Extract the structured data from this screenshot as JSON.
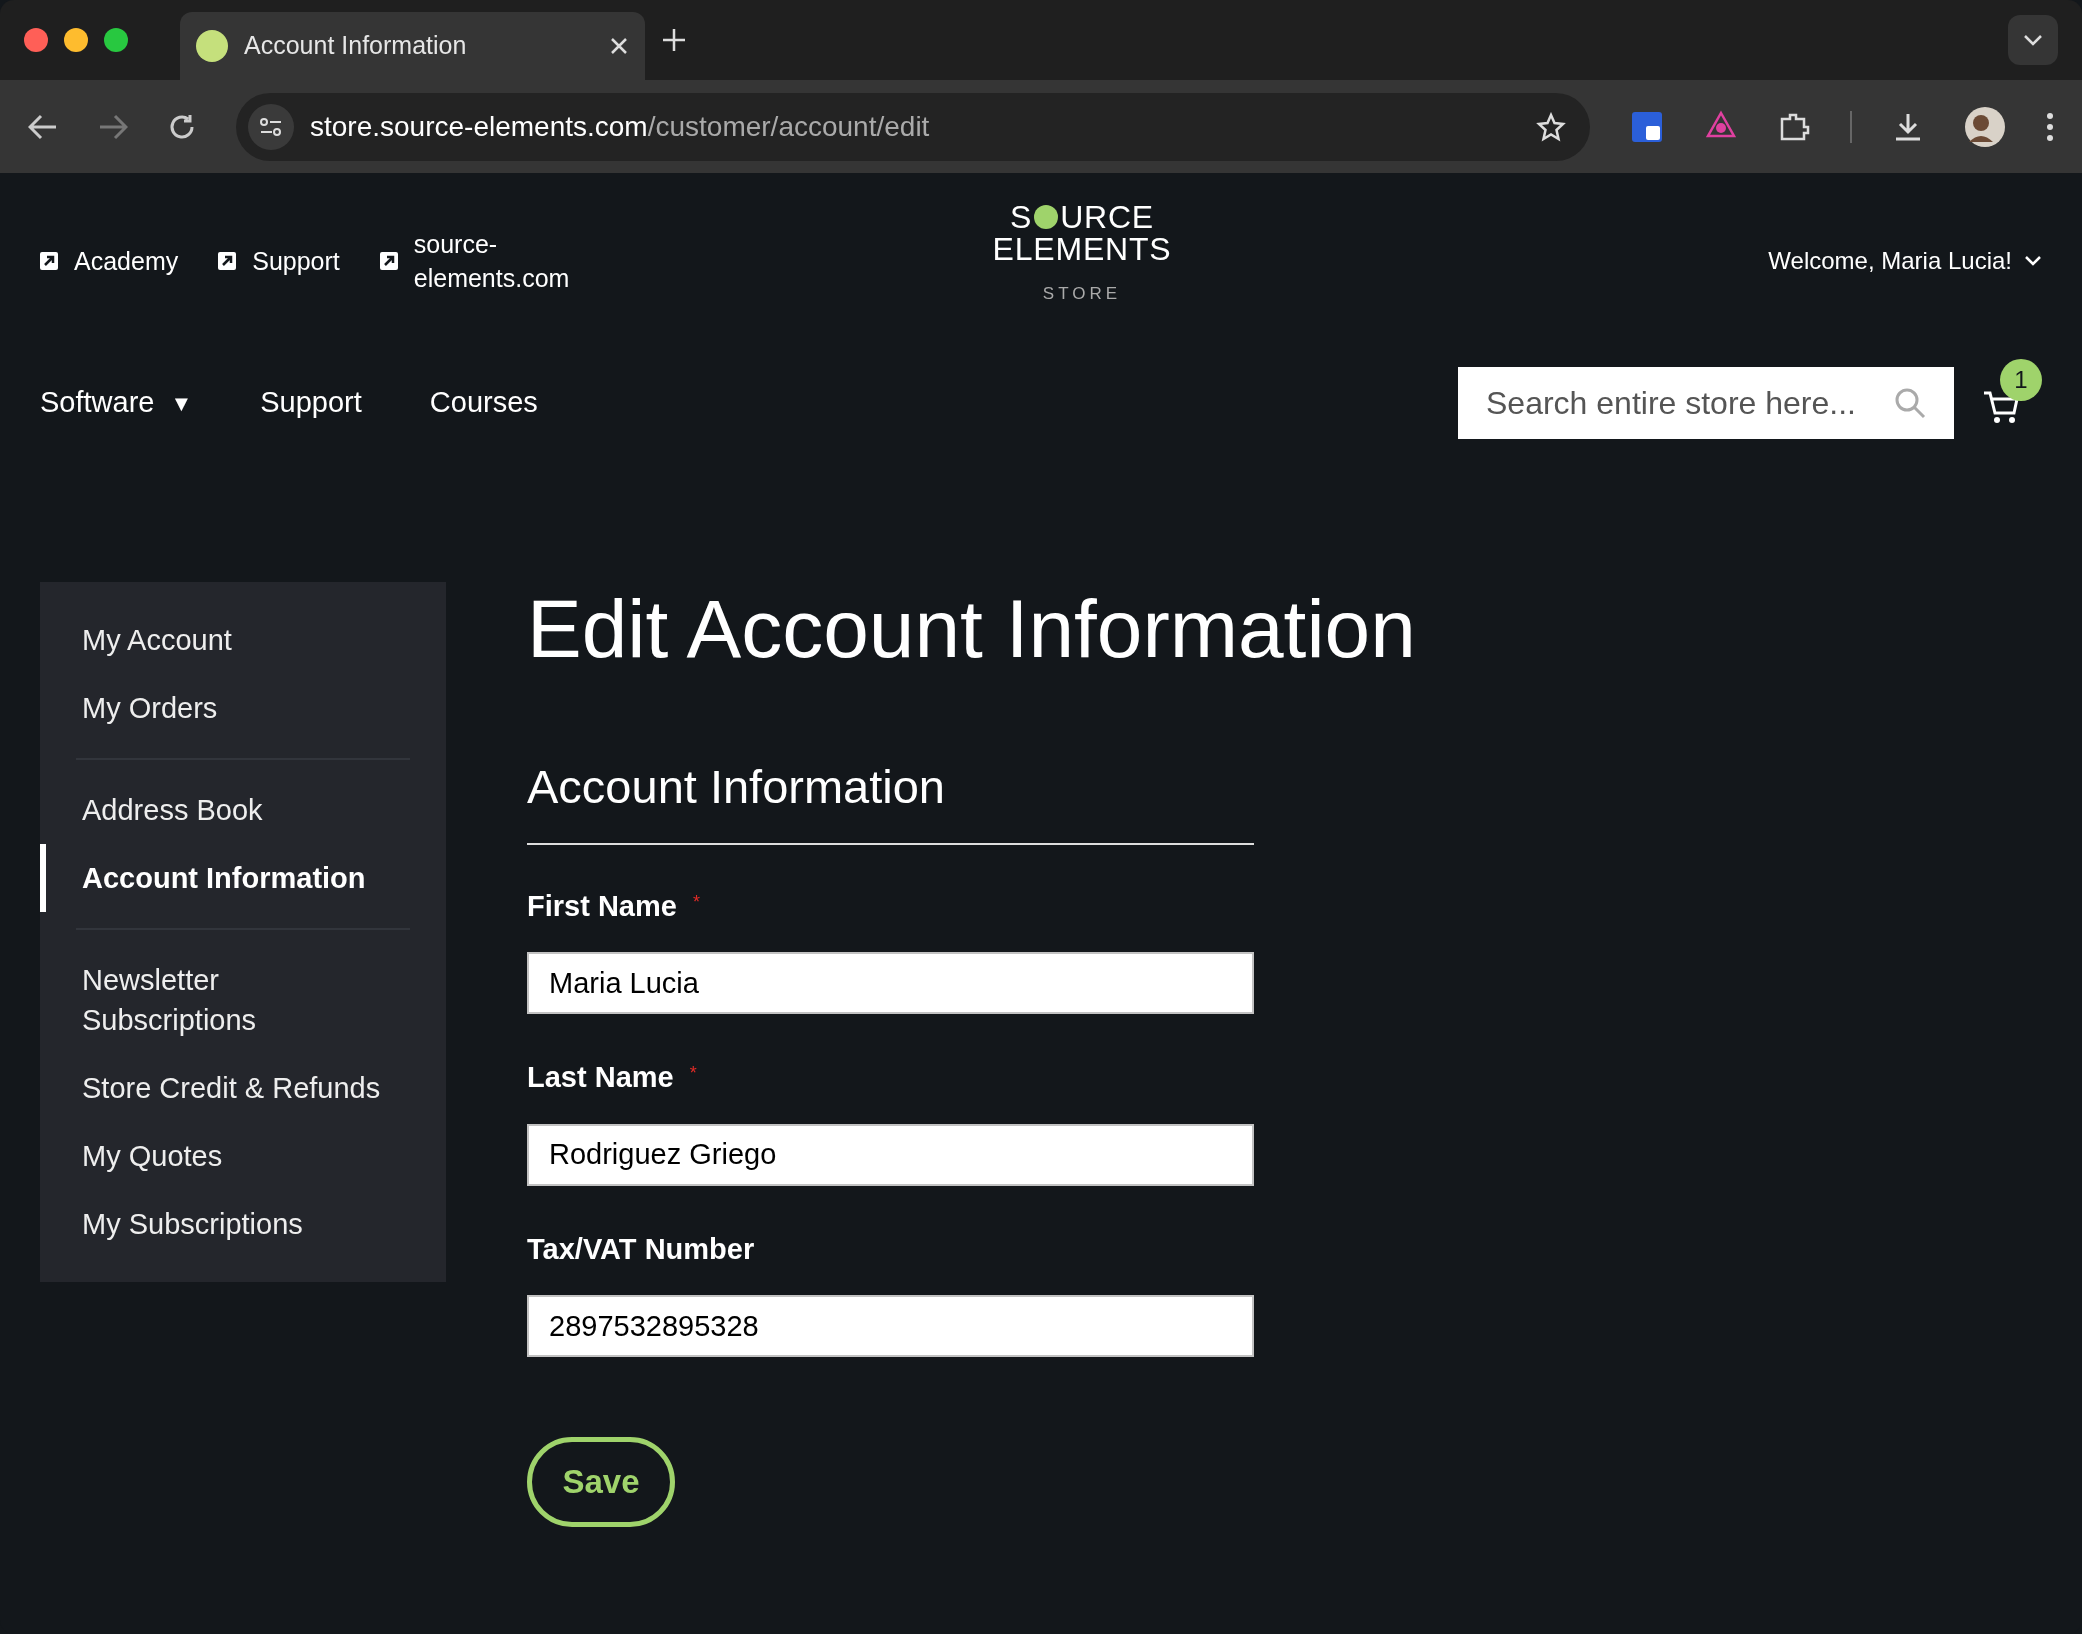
{
  "browser": {
    "tab_title": "Account Information",
    "url_host": "store.source-elements.com",
    "url_path": "/customer/account/edit"
  },
  "top_links": [
    "Academy",
    "Support",
    "source-\nelements.com"
  ],
  "logo": {
    "line_1_before": "S",
    "line_1_after": "URCE",
    "line_2": "ELEMENTS",
    "subtitle": "STORE"
  },
  "welcome": "Welcome, Maria Lucia!",
  "nav": [
    {
      "label": "Software",
      "caret": "▼"
    },
    {
      "label": "Support"
    },
    {
      "label": "Courses"
    }
  ],
  "search": {
    "placeholder": "Search entire store here..."
  },
  "cart": {
    "count": "1"
  },
  "sidebar": {
    "groups": [
      [
        {
          "label": "My Account",
          "selected": false
        },
        {
          "label": "My Orders",
          "selected": false
        }
      ],
      [
        {
          "label": "Address Book",
          "selected": false
        },
        {
          "label": "Account Information",
          "selected": true
        }
      ],
      [
        {
          "label": "Newsletter\nSubscriptions",
          "selected": false
        },
        {
          "label": "Store Credit & Refunds",
          "selected": false
        },
        {
          "label": "My Quotes",
          "selected": false
        },
        {
          "label": "My Subscriptions",
          "selected": false
        }
      ]
    ]
  },
  "page_title": "Edit Account Information",
  "section_title": "Account Information",
  "fields": [
    {
      "label": "First Name",
      "required_mark": "*",
      "value": "Maria Lucia"
    },
    {
      "label": "Last Name",
      "required_mark": "*",
      "value": "Rodriguez Griego"
    },
    {
      "label": "Tax/VAT Number",
      "value": "2897532895328"
    }
  ],
  "save_button": "Save"
}
